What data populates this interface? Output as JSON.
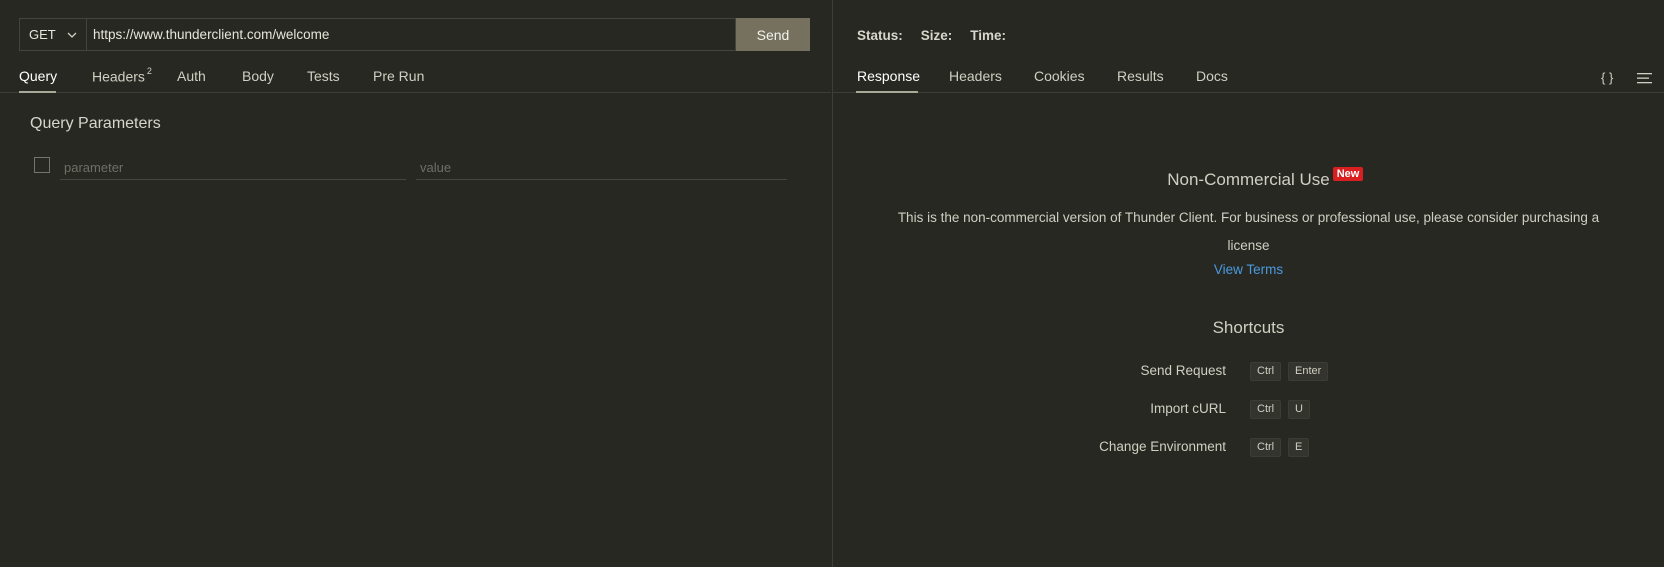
{
  "request": {
    "method": "GET",
    "url": "https://www.thunderclient.com/welcome",
    "send_label": "Send"
  },
  "request_tabs": [
    {
      "label": "Query",
      "active": true
    },
    {
      "label": "Headers",
      "badge": "2"
    },
    {
      "label": "Auth"
    },
    {
      "label": "Body"
    },
    {
      "label": "Tests"
    },
    {
      "label": "Pre Run"
    }
  ],
  "query_params": {
    "title": "Query Parameters",
    "parameter_placeholder": "parameter",
    "value_placeholder": "value"
  },
  "response": {
    "status_label": "Status:",
    "size_label": "Size:",
    "time_label": "Time:",
    "tabs": [
      {
        "label": "Response",
        "active": true
      },
      {
        "label": "Headers"
      },
      {
        "label": "Cookies"
      },
      {
        "label": "Results"
      },
      {
        "label": "Docs"
      }
    ],
    "icons": {
      "braces": "{ }",
      "menu": "hamburger-menu-icon"
    }
  },
  "notice": {
    "title": "Non-Commercial Use",
    "badge": "New",
    "description": "This is the non-commercial version of Thunder Client. For business or professional use, please consider purchasing a license",
    "link": "View Terms"
  },
  "shortcuts": {
    "title": "Shortcuts",
    "items": [
      {
        "label": "Send Request",
        "keys": [
          "Ctrl",
          "Enter"
        ]
      },
      {
        "label": "Import cURL",
        "keys": [
          "Ctrl",
          "U"
        ]
      },
      {
        "label": "Change Environment",
        "keys": [
          "Ctrl",
          "E"
        ]
      }
    ]
  },
  "colors": {
    "background": "#272822",
    "send_button": "#75715e",
    "link": "#4a9ae0",
    "badge": "#d91f1f"
  }
}
